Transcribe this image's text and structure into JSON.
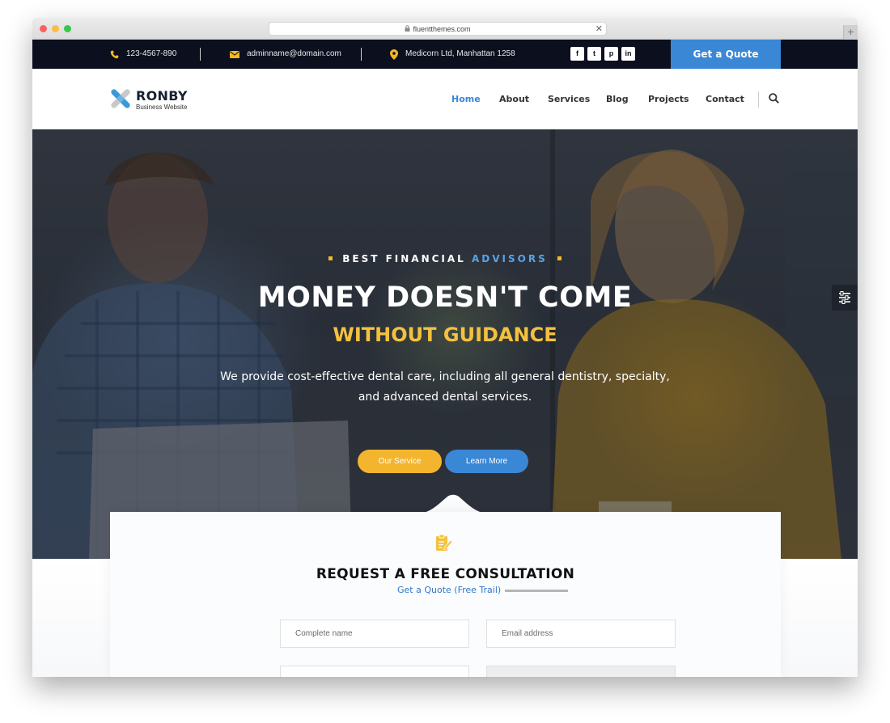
{
  "browser": {
    "url": "fluentthemes.com"
  },
  "topbar": {
    "phone": "123-4567-890",
    "email": "adminname@domain.com",
    "address": "Medicorn Ltd, Manhattan 1258",
    "social": [
      "f",
      "t",
      "p",
      "in"
    ],
    "quote_button": "Get a Quote",
    "accent_color": "#f4b922",
    "bg_color": "#0b0f1e"
  },
  "header": {
    "logo_name": "RONBY",
    "logo_tagline": "Business Website",
    "nav": [
      {
        "label": "Home",
        "active": true
      },
      {
        "label": "About",
        "active": false
      },
      {
        "label": "Services",
        "active": false
      },
      {
        "label": "Blog",
        "active": false
      },
      {
        "label": "Projects",
        "active": false
      },
      {
        "label": "Contact",
        "active": false
      }
    ],
    "active_color": "#3a87d6"
  },
  "hero": {
    "eyebrow_white": "BEST FINANCIAL",
    "eyebrow_blue": "ADVISORS",
    "title": "MONEY DOESN'T COME",
    "subtitle": "WITHOUT GUIDANCE",
    "description_line1": "We provide cost-effective dental care, including all general dentistry, specialty,",
    "description_line2": "and advanced dental services.",
    "primary_button": "Our Service",
    "secondary_button": "Learn More"
  },
  "consultation": {
    "title": "REQUEST A FREE CONSULTATION",
    "subtitle": "Get a Quote (Free Trail)",
    "fields": {
      "name_placeholder": "Complete name",
      "email_placeholder": "Email address"
    }
  }
}
